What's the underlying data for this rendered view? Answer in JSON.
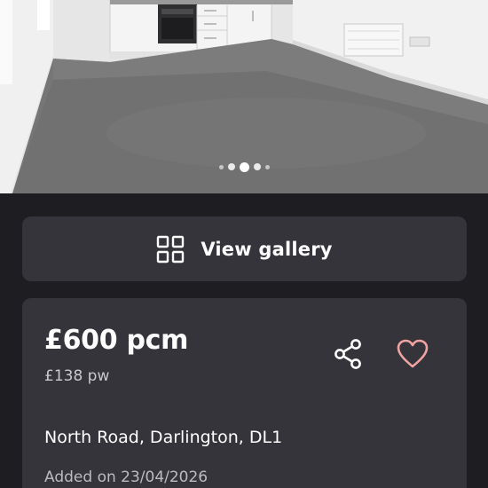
{
  "photo": {
    "alt": "Living room",
    "carousel": {
      "dot_count": 5,
      "active_index": 2
    }
  },
  "gallery_button": {
    "label": "View gallery",
    "icon": "grid-icon"
  },
  "listing": {
    "price": "£600 pcm",
    "price_weekly": "£138 pw",
    "address": "North Road, Darlington, DL1",
    "added": "Added on 23/04/2026",
    "share_icon": "share-icon",
    "favourite_icon": "heart-icon"
  },
  "colors": {
    "background": "#1e1d22",
    "surface": "#35343a",
    "text_primary": "#ffffff",
    "text_secondary": "#c9c8cd",
    "heart": "#f0a3a3"
  }
}
